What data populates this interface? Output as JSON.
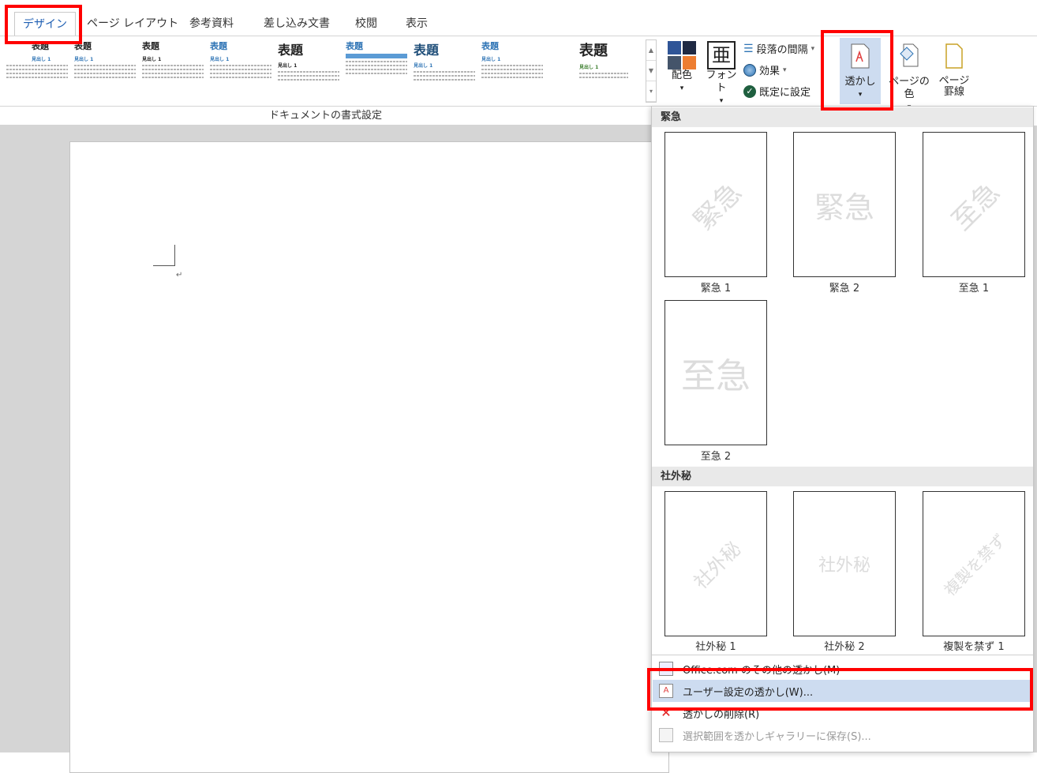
{
  "tabs": [
    {
      "label": "デザイン",
      "active": true
    },
    {
      "label": "ページ レイアウト"
    },
    {
      "label": "参考資料"
    },
    {
      "label": "差し込み文書"
    },
    {
      "label": "校閲"
    },
    {
      "label": "表示"
    }
  ],
  "gallery": {
    "group_label": "ドキュメントの書式設定",
    "title": "表題",
    "heading": "見出し 1"
  },
  "ribbon": {
    "colors": "配色",
    "fonts": "フォント",
    "font_glyph": "亜",
    "paragraph_spacing": "段落の間隔",
    "effects": "効果",
    "set_default": "既定に設定",
    "watermark": "透かし",
    "page_color": "ページの色",
    "page_borders": "ページ\n罫線"
  },
  "dropdown": {
    "sections": [
      "緊急",
      "社外秘"
    ],
    "urgent": [
      {
        "label": "緊急 1",
        "text": "緊急",
        "style": "diagonal"
      },
      {
        "label": "緊急 2",
        "text": "緊急",
        "style": "horizontal"
      },
      {
        "label": "至急 1",
        "text": "至急",
        "style": "diagonal"
      },
      {
        "label": "至急 2",
        "text": "至急",
        "style": "horizontal"
      }
    ],
    "confidential": [
      {
        "label": "社外秘 1",
        "text": "社外秘",
        "style": "diagonal"
      },
      {
        "label": "社外秘 2",
        "text": "社外秘",
        "style": "horizontal"
      },
      {
        "label": "複製を禁ず 1",
        "text": "複製を禁ず",
        "style": "diagonal"
      }
    ],
    "menu": [
      {
        "label": "Office.com のその他の透かし(M)"
      },
      {
        "label": "ユーザー設定の透かし(W)..."
      },
      {
        "label": "透かしの削除(R)"
      },
      {
        "label": "選択範囲を透かしギャラリーに保存(S)..."
      }
    ]
  },
  "colors": {
    "accent": "#1f5fb3",
    "highlight": "#cddcf0",
    "annotation": "#ff0000"
  }
}
